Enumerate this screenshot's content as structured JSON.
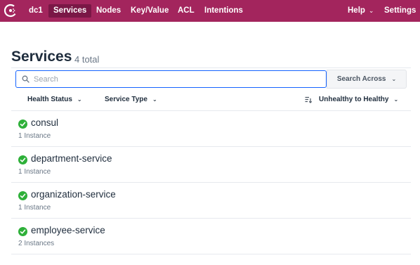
{
  "nav": {
    "logo": "consul-logo-icon",
    "datacenter": "dc1",
    "items": [
      {
        "label": "Services",
        "active": true
      },
      {
        "label": "Nodes",
        "active": false
      },
      {
        "label": "Key/Value",
        "active": false
      },
      {
        "label": "ACL",
        "active": false
      },
      {
        "label": "Intentions",
        "active": false
      }
    ],
    "help_label": "Help",
    "settings_label": "Settings",
    "chevron": "⌄",
    "colors": {
      "bar": "#a3255d",
      "active": "#7a1746"
    }
  },
  "header": {
    "title": "Services",
    "count": "4 total"
  },
  "search": {
    "placeholder": "Search",
    "value": "",
    "across_label": "Search Across"
  },
  "filters": {
    "health_status": "Health Status",
    "service_type": "Service Type",
    "sort_label": "Unhealthy to Healthy"
  },
  "services": [
    {
      "name": "consul",
      "instances": "1 Instance",
      "status": "passing"
    },
    {
      "name": "department-service",
      "instances": "1 Instance",
      "status": "passing"
    },
    {
      "name": "organization-service",
      "instances": "1 Instance",
      "status": "passing"
    },
    {
      "name": "employee-service",
      "instances": "2 Instances",
      "status": "passing"
    }
  ],
  "colors": {
    "passing": "#2eb039",
    "focus": "#1563ff"
  }
}
